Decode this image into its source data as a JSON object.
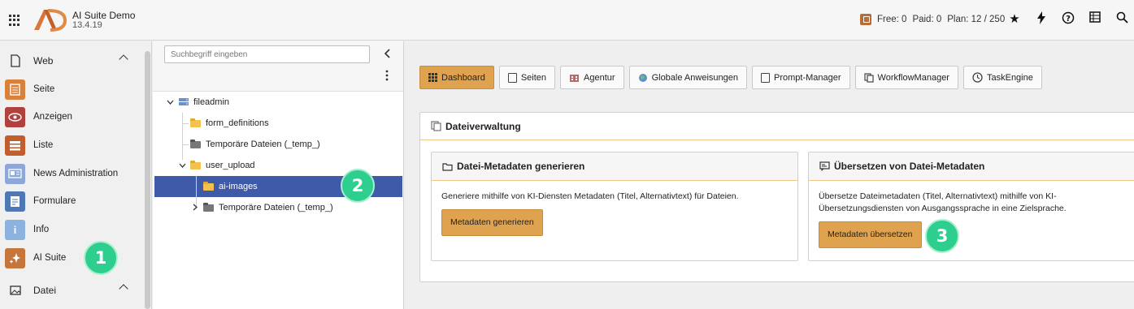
{
  "topbar": {
    "app_title": "AI Suite Demo",
    "app_version": "13.4.19",
    "credits": {
      "free": "Free: 0",
      "paid": "Paid: 0",
      "plan": "Plan: 12 / 250"
    },
    "icons": [
      "star-icon",
      "bolt-icon",
      "help-icon",
      "list-icon",
      "search-icon"
    ]
  },
  "sidebar": {
    "groups": [
      {
        "label": "Web"
      },
      {
        "label": "Datei"
      }
    ],
    "items": [
      {
        "label": "Seite",
        "color": "#d9813a"
      },
      {
        "label": "Anzeigen",
        "color": "#b0413e"
      },
      {
        "label": "Liste",
        "color": "#c45d2c"
      },
      {
        "label": "News Administration",
        "color": "#8ea7d9"
      },
      {
        "label": "Formulare",
        "color": "#4e79b5"
      },
      {
        "label": "Info",
        "color": "#8cb3e0"
      },
      {
        "label": "AI Suite",
        "color": "#c6763a"
      }
    ]
  },
  "tree": {
    "search_placeholder": "Suchbegriff eingeben",
    "nodes": [
      {
        "label": "fileadmin"
      },
      {
        "label": "form_definitions"
      },
      {
        "label": "Temporäre Dateien (_temp_)"
      },
      {
        "label": "user_upload"
      },
      {
        "label": "ai-images"
      },
      {
        "label": "Temporäre Dateien (_temp_)"
      }
    ]
  },
  "nav": {
    "buttons": [
      {
        "label": "Dashboard"
      },
      {
        "label": "Seiten"
      },
      {
        "label": "Agentur"
      },
      {
        "label": "Globale Anweisungen"
      },
      {
        "label": "Prompt-Manager"
      },
      {
        "label": "WorkflowManager"
      },
      {
        "label": "TaskEngine"
      }
    ]
  },
  "content": {
    "section_title": "Dateiverwaltung",
    "card1": {
      "title": "Datei-Metadaten generieren",
      "text": "Generiere mithilfe von KI-Diensten Metadaten (Titel, Alternativtext) für Dateien.",
      "button": "Metadaten generieren"
    },
    "card2": {
      "title": "Übersetzen von Datei-Metadaten",
      "text": "Übersetze Dateimetadaten (Titel, Alternativtext) mithilfe von KI-Übersetzungsdiensten von Ausgangssprache in eine Zielsprache.",
      "button": "Metadaten übersetzen"
    }
  },
  "badges": [
    "1",
    "2",
    "3"
  ],
  "colors": {
    "accent": "#dfa24e",
    "selected": "#3f5aa8",
    "badge": "#2ecf8e"
  }
}
